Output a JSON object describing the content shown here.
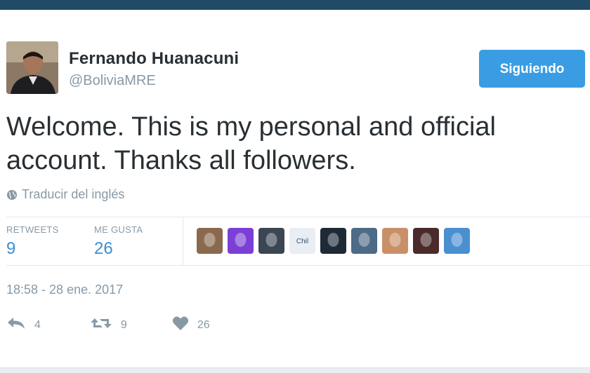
{
  "tweet": {
    "author_name": "Fernando Huanacuni",
    "author_handle": "@BoliviaMRE",
    "follow_button_label": "Siguiendo",
    "text": "Welcome. This is my personal and official account. Thanks all followers.",
    "translate_label": "Traducir del inglés",
    "timestamp": "18:58 - 28 ene. 2017"
  },
  "stats": {
    "retweets_label": "RETWEETS",
    "retweets_value": "9",
    "likes_label": "ME GUSTA",
    "likes_value": "26"
  },
  "actions": {
    "reply_count": "4",
    "retweet_count": "9",
    "like_count": "26"
  },
  "liker_avatars": [
    {
      "color": "#8a6a4e"
    },
    {
      "color": "#7b3fd6"
    },
    {
      "color": "#3b4654"
    },
    {
      "color": "#e9eef4",
      "text": "Chil"
    },
    {
      "color": "#1e2a36"
    },
    {
      "color": "#4d6a86"
    },
    {
      "color": "#c99068"
    },
    {
      "color": "#4a2a2a"
    },
    {
      "color": "#4b8fd1"
    }
  ],
  "colors": {
    "accent": "#3a9de3",
    "stat_value": "#3a8fd1",
    "muted": "#8899a6",
    "top_bar": "#1f4a68"
  }
}
